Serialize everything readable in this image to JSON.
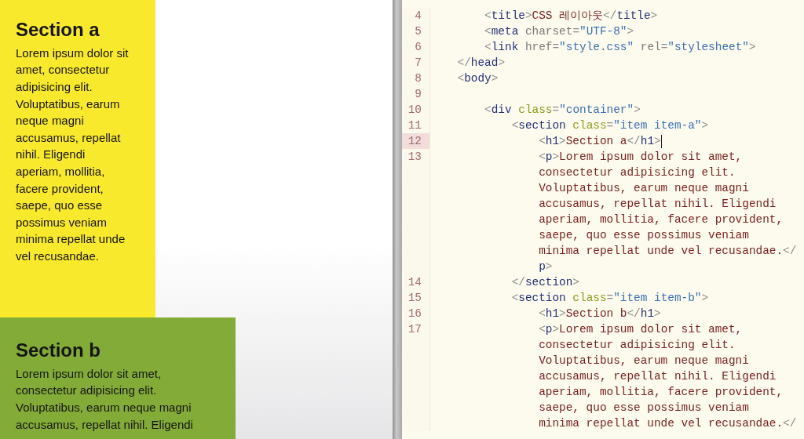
{
  "preview": {
    "sections": [
      {
        "heading": "Section a",
        "body": "Lorem ipsum dolor sit amet, consectetur adipisicing elit. Voluptatibus, earum neque magni accusamus, repellat nihil. Eligendi aperiam, mollitia, facere provident, saepe, quo esse possimus veniam minima repellat unde vel recusandae.",
        "color": "#f9e92c"
      },
      {
        "heading": "Section b",
        "body": "Lorem ipsum dolor sit amet, consectetur adipisicing elit. Voluptatibus, earum neque magni accusamus, repellat nihil. Eligendi",
        "color": "#83ab37"
      }
    ]
  },
  "editor": {
    "lines": [
      {
        "number": "4",
        "current": false,
        "rows": [
          {
            "tokens": [
              {
                "kind": "bracket",
                "text": "        <"
              },
              {
                "kind": "tag",
                "text": "title"
              },
              {
                "kind": "bracket",
                "text": ">"
              },
              {
                "kind": "text",
                "text": "CSS 레이아웃"
              },
              {
                "kind": "bracket",
                "text": "</"
              },
              {
                "kind": "tag",
                "text": "title"
              },
              {
                "kind": "bracket",
                "text": ">"
              }
            ]
          }
        ]
      },
      {
        "number": "5",
        "current": false,
        "rows": [
          {
            "tokens": [
              {
                "kind": "bracket",
                "text": "        <"
              },
              {
                "kind": "tag",
                "text": "meta"
              },
              {
                "kind": "attr",
                "text": " charset"
              },
              {
                "kind": "bracket",
                "text": "="
              },
              {
                "kind": "value",
                "text": "\"UTF-8\""
              },
              {
                "kind": "bracket",
                "text": ">"
              }
            ]
          }
        ]
      },
      {
        "number": "6",
        "current": false,
        "rows": [
          {
            "tokens": [
              {
                "kind": "bracket",
                "text": "        <"
              },
              {
                "kind": "tag",
                "text": "link"
              },
              {
                "kind": "attr",
                "text": " href"
              },
              {
                "kind": "bracket",
                "text": "="
              },
              {
                "kind": "value",
                "text": "\"style.css\""
              },
              {
                "kind": "attr",
                "text": " rel"
              },
              {
                "kind": "bracket",
                "text": "="
              },
              {
                "kind": "value",
                "text": "\"stylesheet\""
              },
              {
                "kind": "bracket",
                "text": ">"
              }
            ]
          }
        ]
      },
      {
        "number": "7",
        "current": false,
        "rows": [
          {
            "tokens": [
              {
                "kind": "bracket",
                "text": "    </"
              },
              {
                "kind": "tag",
                "text": "head"
              },
              {
                "kind": "bracket",
                "text": ">"
              }
            ]
          }
        ]
      },
      {
        "number": "8",
        "current": false,
        "rows": [
          {
            "tokens": [
              {
                "kind": "bracket",
                "text": "    <"
              },
              {
                "kind": "tag",
                "text": "body"
              },
              {
                "kind": "bracket",
                "text": ">"
              }
            ]
          }
        ]
      },
      {
        "number": "9",
        "current": false
      },
      {
        "number": "10",
        "current": false,
        "rows": [
          {
            "tokens": [
              {
                "kind": "bracket",
                "text": "        <"
              },
              {
                "kind": "tag",
                "text": "div"
              },
              {
                "kind": "class-attr",
                "text": " class"
              },
              {
                "kind": "bracket",
                "text": "="
              },
              {
                "kind": "value",
                "text": "\"container\""
              },
              {
                "kind": "bracket",
                "text": ">"
              }
            ]
          }
        ]
      },
      {
        "number": "11",
        "current": false,
        "rows": [
          {
            "tokens": [
              {
                "kind": "bracket",
                "text": "            <"
              },
              {
                "kind": "tag",
                "text": "section"
              },
              {
                "kind": "class-attr",
                "text": " class"
              },
              {
                "kind": "bracket",
                "text": "="
              },
              {
                "kind": "value",
                "text": "\"item item-a\""
              },
              {
                "kind": "bracket",
                "text": ">"
              }
            ]
          }
        ]
      },
      {
        "number": "12",
        "current": true,
        "rows": [
          {
            "tokens": [
              {
                "kind": "bracket",
                "text": "                <"
              },
              {
                "kind": "tag",
                "text": "h1"
              },
              {
                "kind": "bracket",
                "text": ">"
              },
              {
                "kind": "text",
                "text": "Section a"
              },
              {
                "kind": "bracket",
                "text": "</"
              },
              {
                "kind": "tag",
                "text": "h1"
              },
              {
                "kind": "bracket",
                "text": ">"
              }
            ]
          }
        ]
      },
      {
        "number": "13",
        "current": false,
        "rows": [
          {
            "tokens": [
              {
                "kind": "bracket",
                "text": "                <"
              },
              {
                "kind": "tag",
                "text": "p"
              },
              {
                "kind": "bracket",
                "text": ">"
              },
              {
                "kind": "text",
                "text": "Lorem ipsum dolor sit amet,"
              }
            ]
          },
          {
            "tokens": [
              {
                "kind": "text",
                "text": "                consectetur adipisicing elit."
              }
            ]
          },
          {
            "tokens": [
              {
                "kind": "text",
                "text": "                Voluptatibus, earum neque magni"
              }
            ]
          },
          {
            "tokens": [
              {
                "kind": "text",
                "text": "                accusamus, repellat nihil. Eligendi"
              }
            ]
          },
          {
            "tokens": [
              {
                "kind": "text",
                "text": "                aperiam, mollitia, facere provident,"
              }
            ]
          },
          {
            "tokens": [
              {
                "kind": "text",
                "text": "                saepe, quo esse possimus veniam"
              }
            ]
          },
          {
            "tokens": [
              {
                "kind": "text",
                "text": "                minima repellat unde vel recusandae."
              },
              {
                "kind": "bracket",
                "text": "</"
              }
            ]
          },
          {
            "tokens": [
              {
                "kind": "tag",
                "text": "                p"
              },
              {
                "kind": "bracket",
                "text": ">"
              }
            ]
          }
        ]
      },
      {
        "number": "14",
        "current": false,
        "rows": [
          {
            "tokens": [
              {
                "kind": "bracket",
                "text": "            </"
              },
              {
                "kind": "tag",
                "text": "section"
              },
              {
                "kind": "bracket",
                "text": ">"
              }
            ]
          }
        ]
      },
      {
        "number": "15",
        "current": false,
        "rows": [
          {
            "tokens": [
              {
                "kind": "bracket",
                "text": "            <"
              },
              {
                "kind": "tag",
                "text": "section"
              },
              {
                "kind": "class-attr",
                "text": " class"
              },
              {
                "kind": "bracket",
                "text": "="
              },
              {
                "kind": "value",
                "text": "\"item item-b\""
              },
              {
                "kind": "bracket",
                "text": ">"
              }
            ]
          }
        ]
      },
      {
        "number": "16",
        "current": false,
        "rows": [
          {
            "tokens": [
              {
                "kind": "bracket",
                "text": "                <"
              },
              {
                "kind": "tag",
                "text": "h1"
              },
              {
                "kind": "bracket",
                "text": ">"
              },
              {
                "kind": "text",
                "text": "Section b"
              },
              {
                "kind": "bracket",
                "text": "</"
              },
              {
                "kind": "tag",
                "text": "h1"
              },
              {
                "kind": "bracket",
                "text": ">"
              }
            ]
          }
        ]
      },
      {
        "number": "17",
        "current": false,
        "rows": [
          {
            "tokens": [
              {
                "kind": "bracket",
                "text": "                <"
              },
              {
                "kind": "tag",
                "text": "p"
              },
              {
                "kind": "bracket",
                "text": ">"
              },
              {
                "kind": "text",
                "text": "Lorem ipsum dolor sit amet,"
              }
            ]
          },
          {
            "tokens": [
              {
                "kind": "text",
                "text": "                consectetur adipisicing elit."
              }
            ]
          },
          {
            "tokens": [
              {
                "kind": "text",
                "text": "                Voluptatibus, earum neque magni"
              }
            ]
          },
          {
            "tokens": [
              {
                "kind": "text",
                "text": "                accusamus, repellat nihil. Eligendi"
              }
            ]
          },
          {
            "tokens": [
              {
                "kind": "text",
                "text": "                aperiam, mollitia, facere provident,"
              }
            ]
          },
          {
            "tokens": [
              {
                "kind": "text",
                "text": "                saepe, quo esse possimus veniam"
              }
            ]
          },
          {
            "tokens": [
              {
                "kind": "text",
                "text": "                minima repellat unde vel recusandae."
              },
              {
                "kind": "bracket",
                "text": "</"
              }
            ]
          }
        ]
      }
    ]
  }
}
